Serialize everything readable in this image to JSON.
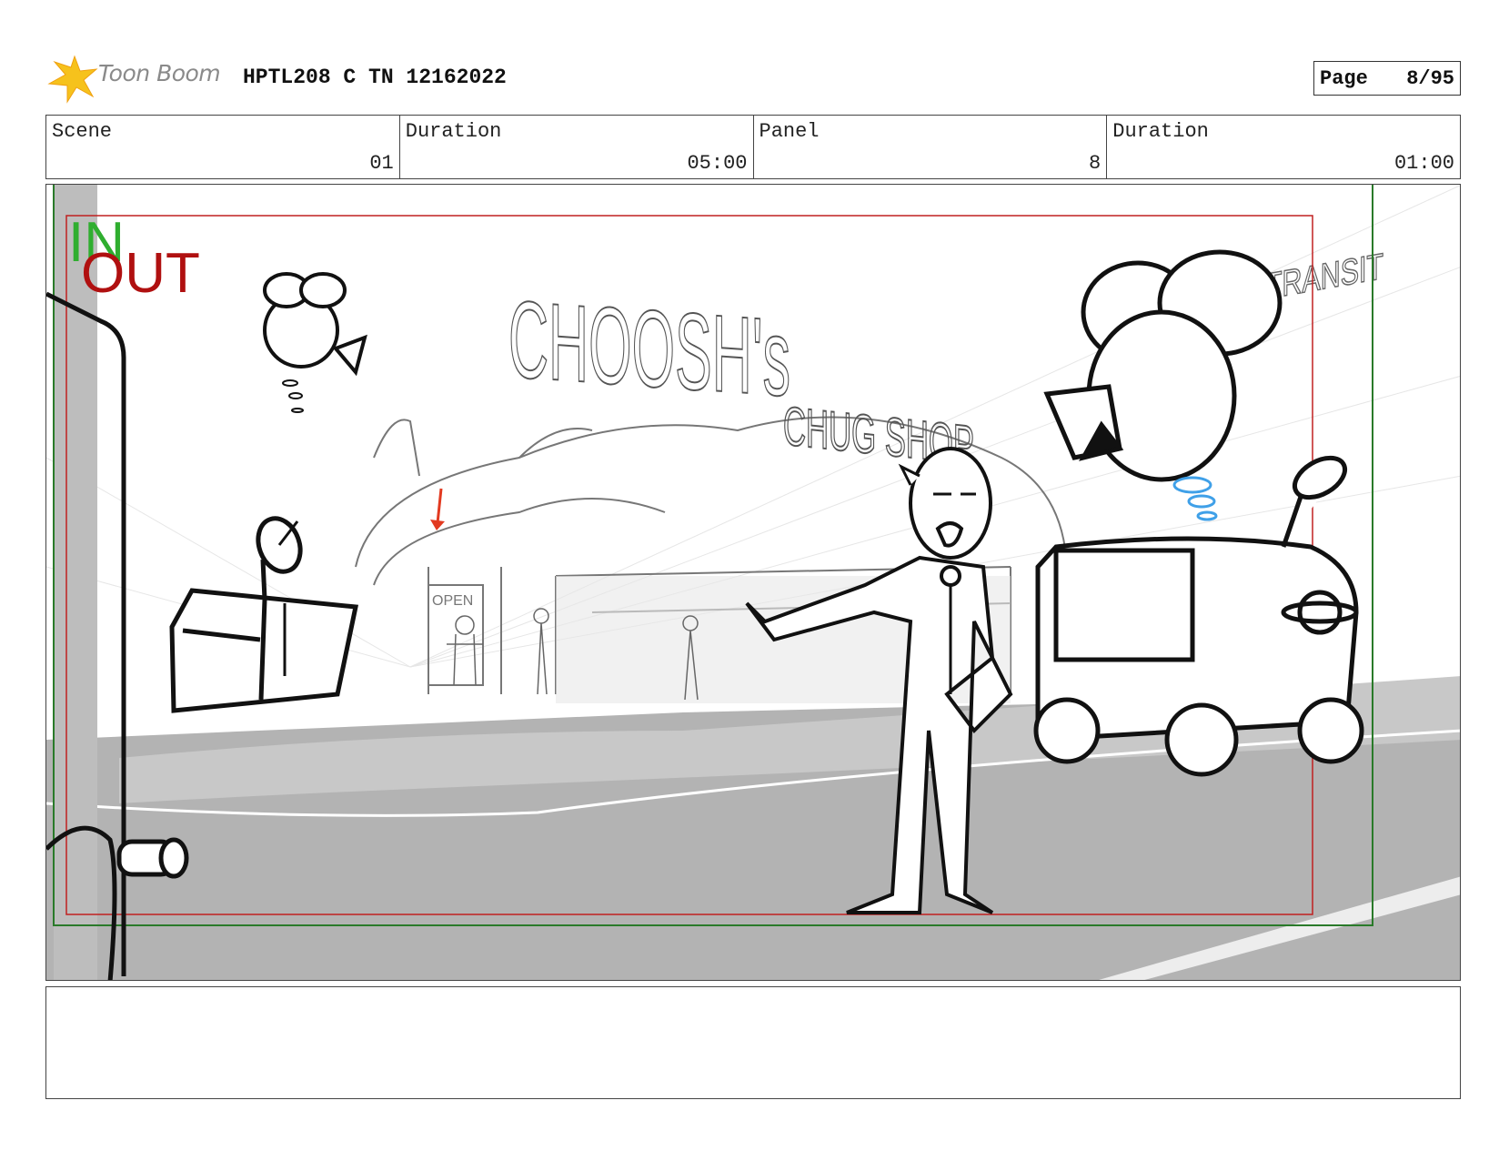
{
  "header": {
    "logo_text": "Toon Boom",
    "project_title": "HPTL208 C TN 12162022",
    "page_label": "Page",
    "page_number": "8/95"
  },
  "info": {
    "scene_label": "Scene",
    "scene_value": "01",
    "scene_duration_label": "Duration",
    "scene_duration_value": "05:00",
    "panel_label": "Panel",
    "panel_value": "8",
    "panel_duration_label": "Duration",
    "panel_duration_value": "01:00"
  },
  "panel": {
    "in_marker": "IN",
    "out_marker": "OUT",
    "sign_choosh": "CHOOSH's",
    "sign_chug": "CHUG SHOP",
    "sign_transit": "TRANSIT",
    "sign_open": "OPEN",
    "colors": {
      "in_green": "#2fae2f",
      "out_red": "#b01010",
      "safe_frame_green": "#2a7a2a",
      "safe_frame_red": "#c02020",
      "road_gray": "#b3b3b3",
      "accent_blue": "#3fa0e8",
      "arrow_red": "#e23a20"
    }
  },
  "notes": {
    "text": ""
  }
}
